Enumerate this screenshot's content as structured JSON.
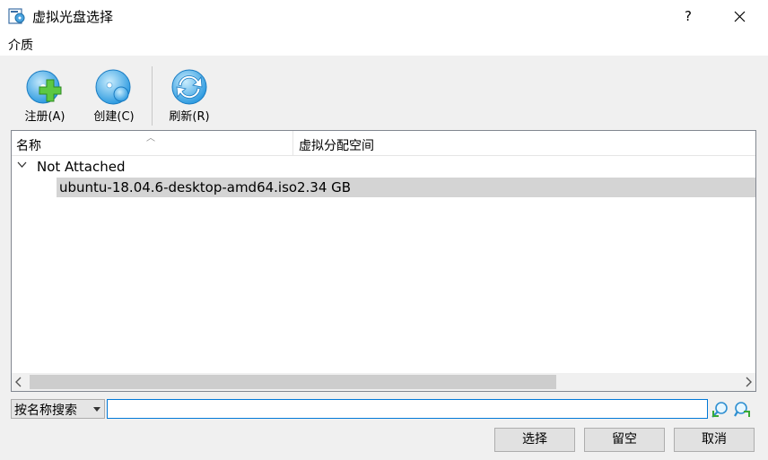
{
  "window": {
    "title": "虚拟光盘选择",
    "help_label": "?"
  },
  "menubar": {
    "items": [
      {
        "label": "介质"
      }
    ]
  },
  "toolbar": {
    "register_label": "注册(A)",
    "create_label": "创建(C)",
    "refresh_label": "刷新(R)"
  },
  "table": {
    "columns": [
      "名称",
      "虚拟分配空间"
    ],
    "groups": [
      {
        "label": "Not Attached",
        "expanded": true,
        "items": [
          {
            "name": "ubuntu-18.04.6-desktop-amd64.iso",
            "size": "2.34 GB",
            "selected": true
          }
        ]
      }
    ]
  },
  "search": {
    "mode_label": "按名称搜索",
    "value": "",
    "placeholder": ""
  },
  "buttons": {
    "choose": "选择",
    "leave_empty": "留空",
    "cancel": "取消"
  },
  "colors": {
    "accent": "#0078d7",
    "selection": "#d4d4d4",
    "icon_blue": "#3aa5e0",
    "icon_green": "#4cbb3b"
  },
  "icons": [
    "optical-disk-icon",
    "register-icon",
    "create-icon",
    "refresh-icon",
    "search-backward-icon",
    "search-forward-icon"
  ]
}
